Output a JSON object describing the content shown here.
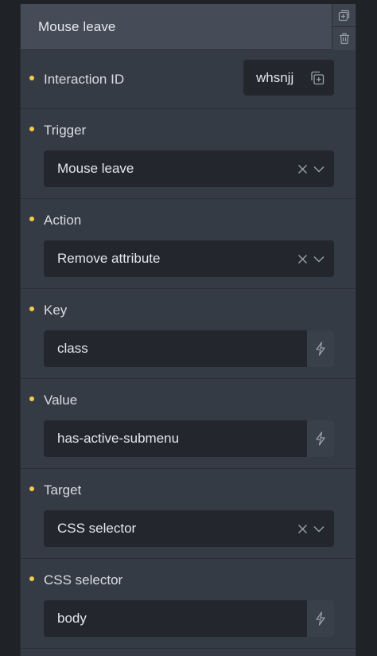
{
  "header": {
    "title": "Mouse leave"
  },
  "fields": {
    "interaction_id": {
      "label": "Interaction ID",
      "value": "whsnjj"
    },
    "trigger": {
      "label": "Trigger",
      "value": "Mouse leave"
    },
    "action": {
      "label": "Action",
      "value": "Remove attribute"
    },
    "key": {
      "label": "Key",
      "value": "class"
    },
    "value": {
      "label": "Value",
      "value": "has-active-submenu"
    },
    "target": {
      "label": "Target",
      "value": "CSS selector"
    },
    "css_selector": {
      "label": "CSS selector",
      "value": "body"
    }
  },
  "icons": {
    "duplicate": "duplicate-icon",
    "delete": "trash-icon",
    "copy": "copy-icon",
    "clear": "close-icon",
    "dropdown": "chevron-down-icon",
    "dynamic_data": "bolt-icon"
  },
  "colors": {
    "required_dot": "#f5cc4a",
    "panel": "#353b45",
    "header": "#454c57",
    "input": "#23272d"
  }
}
